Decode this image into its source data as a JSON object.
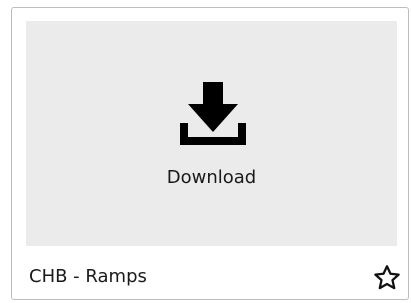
{
  "card": {
    "title": "CHB - Ramps",
    "preview": {
      "action_label": "Download",
      "icon": "download-icon",
      "background_color": "#ebebeb"
    },
    "favorite_icon": "star-outline-icon"
  }
}
